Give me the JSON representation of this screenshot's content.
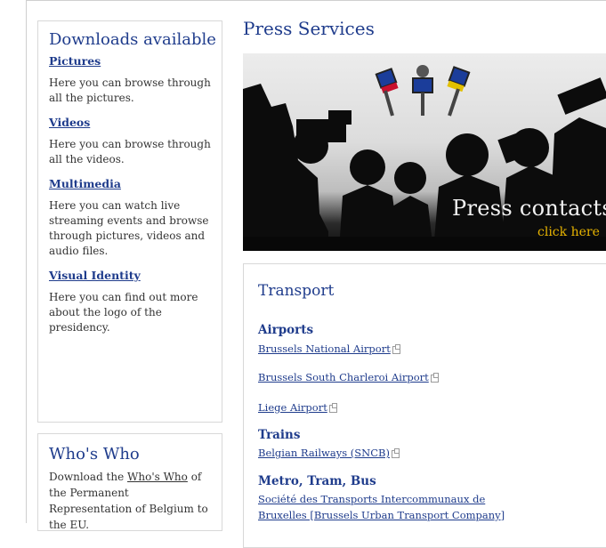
{
  "sidebar": {
    "downloads": {
      "title": "Downloads available",
      "items": [
        {
          "heading": "Pictures",
          "text": "Here you can browse through all the pictures."
        },
        {
          "heading": "Videos",
          "text": "Here you can browse through all the videos."
        },
        {
          "heading": "Multimedia",
          "text": "Here you can watch live streaming events and browse through pictures, videos and audio files."
        },
        {
          "heading": "Visual Identity",
          "text": "Here you can find out more about the logo of the presidency."
        }
      ]
    },
    "whoswho": {
      "title": "Who's Who",
      "text_before": "Download the ",
      "link": "Who's Who",
      "text_after": " of the Permanent Representation of Belgium to the EU."
    }
  },
  "main": {
    "title": "Press Services",
    "banner": {
      "caption": "Press contacts",
      "link": "click here"
    },
    "transport": {
      "title": "Transport",
      "airports_heading": "Airports",
      "airport_links": [
        "Brussels National Airport",
        "Brussels South Charleroi Airport",
        "Liege Airport"
      ],
      "trains_heading": "Trains",
      "train_links": [
        "Belgian Railways (SNCB)"
      ],
      "metro_heading": "Metro, Tram, Bus",
      "metro_links": [
        "Société des Transports Intercommunaux de",
        "Bruxelles [Brussels Urban Transport Company]"
      ]
    }
  },
  "colors": {
    "accent": "#1f3c8c",
    "banner_link": "#e8b400"
  }
}
